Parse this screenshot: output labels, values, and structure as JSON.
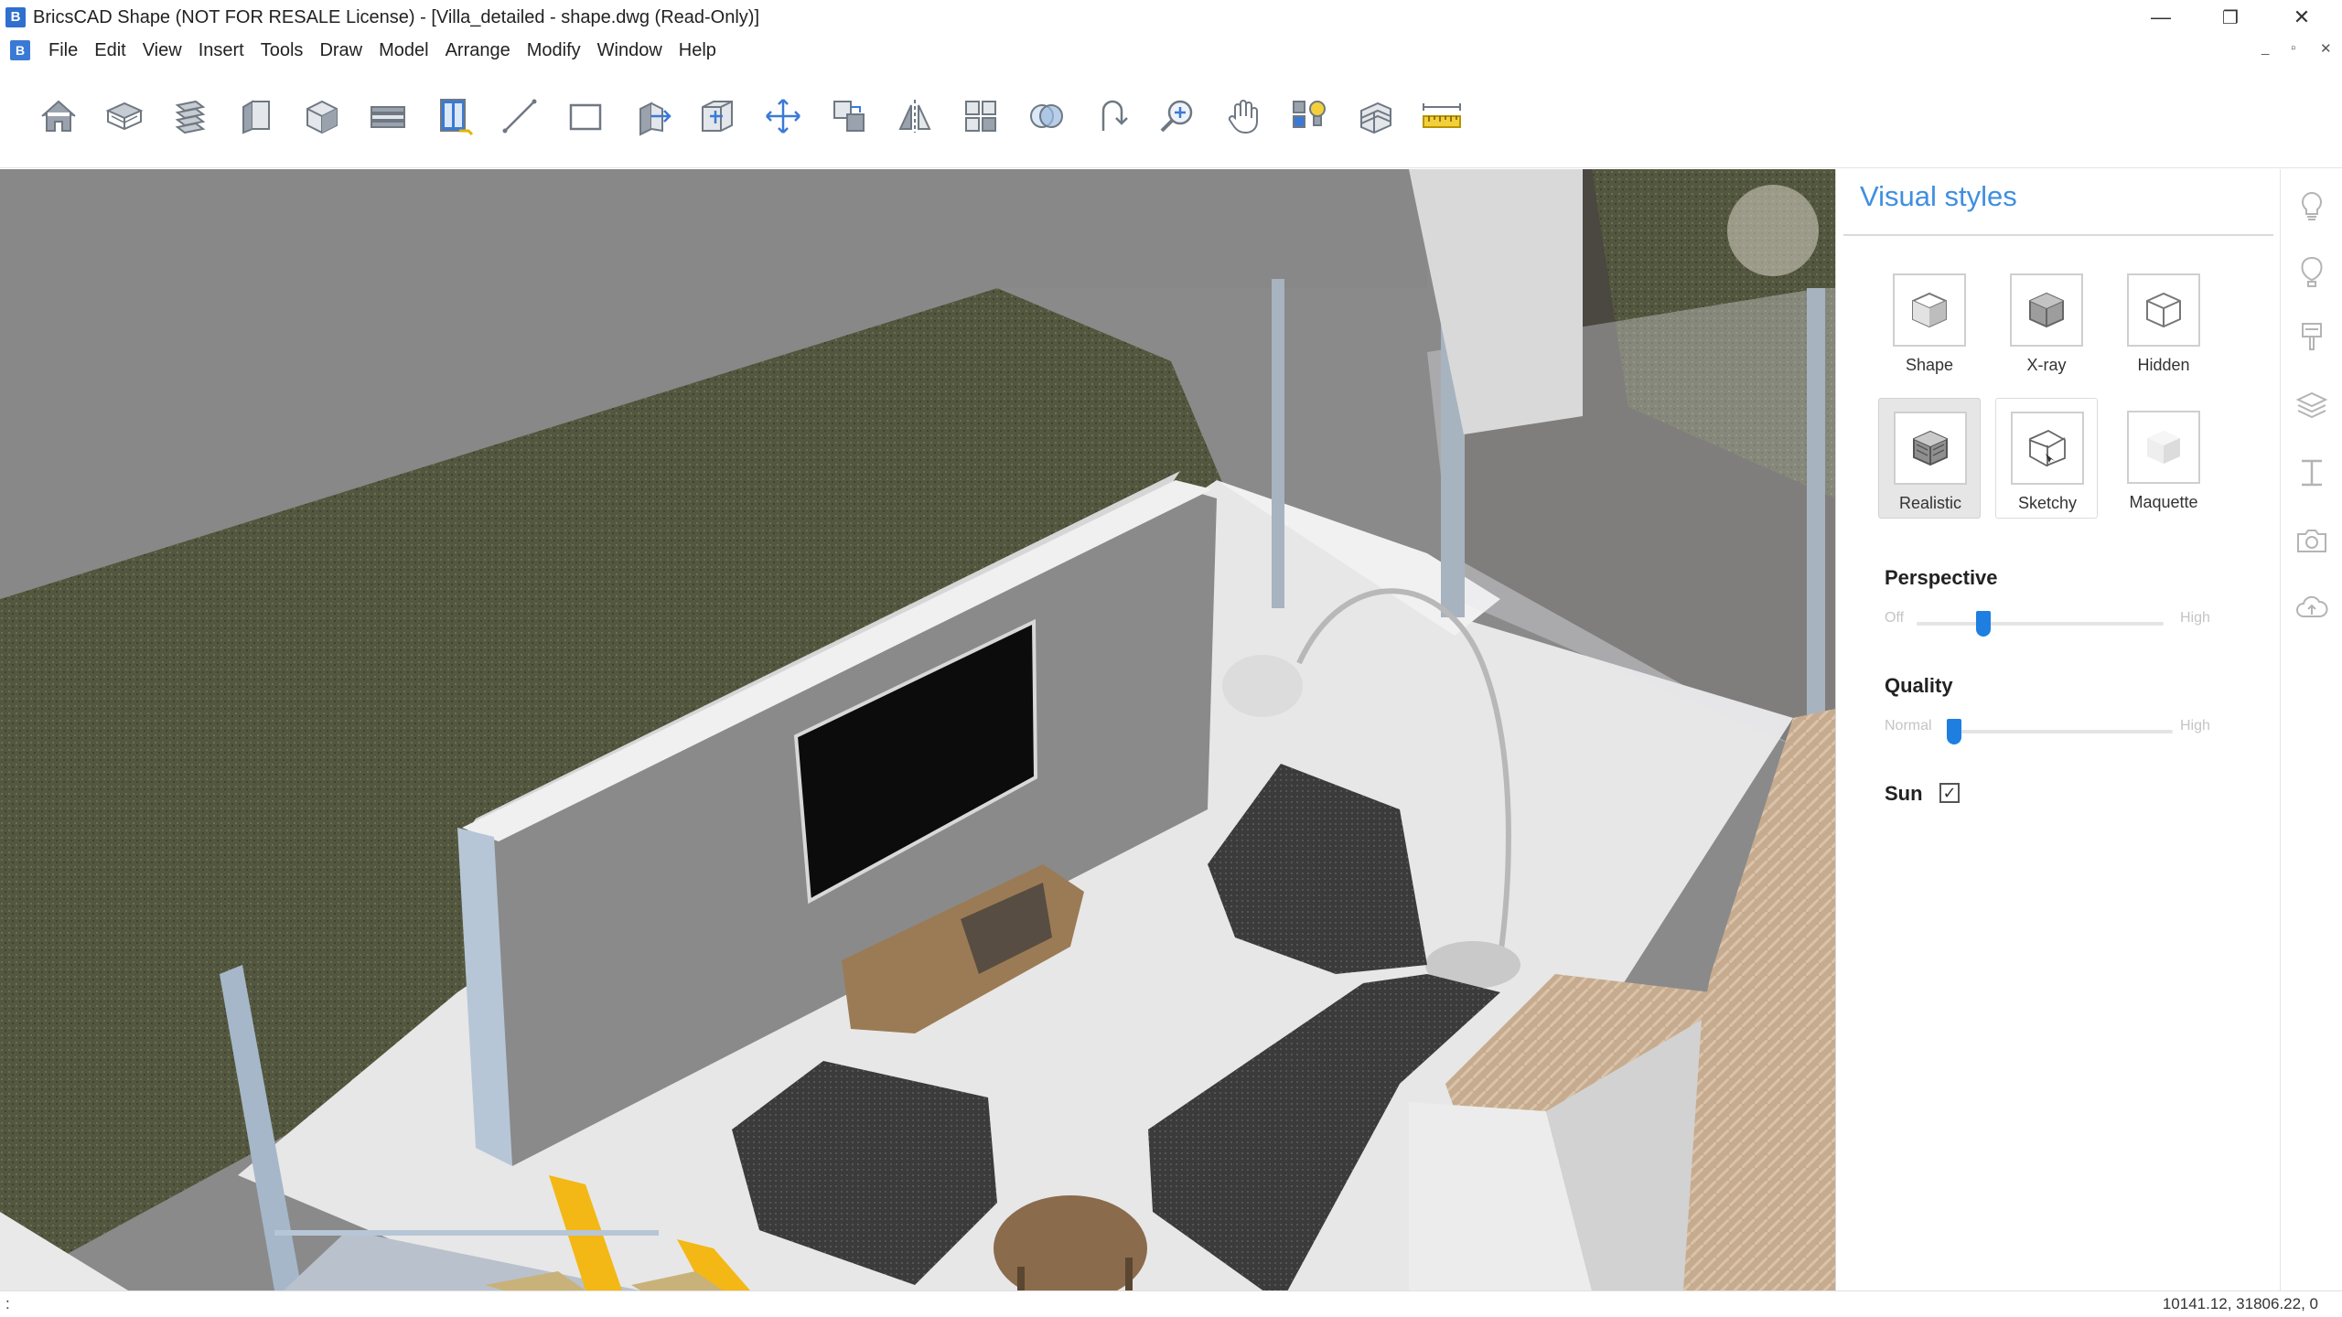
{
  "window": {
    "title": "BricsCAD Shape (NOT FOR RESALE License) - [Villa_detailed - shape.dwg (Read-Only)]",
    "app_icon": "bricscad-logo",
    "controls": {
      "minimize": "—",
      "restore": "❐",
      "close": "✕"
    },
    "doc_controls": {
      "minimize": "_",
      "restore": "▫",
      "close": "✕"
    }
  },
  "menu": {
    "items": [
      "File",
      "Edit",
      "View",
      "Insert",
      "Tools",
      "Draw",
      "Model",
      "Arrange",
      "Modify",
      "Window",
      "Help"
    ]
  },
  "toolbar": {
    "tools": [
      "home-icon",
      "floor-slab-icon",
      "stair-icon",
      "wall-icon",
      "box-icon",
      "beam-icon",
      "window-library-icon",
      "line-icon",
      "rectangle-icon",
      "push-pull-icon",
      "section-box-icon",
      "move-icon",
      "copy-icon",
      "mirror-icon",
      "array-icon",
      "solid-boolean-icon",
      "rotate-icon",
      "zoom-icon",
      "pan-icon",
      "lighting-icon",
      "layer-section-icon",
      "measure-tape-icon"
    ]
  },
  "panel": {
    "title": "Visual styles",
    "styles": [
      {
        "label": "Shape",
        "icon": "shape-cube-icon",
        "selected": false
      },
      {
        "label": "X-ray",
        "icon": "xray-cube-icon",
        "selected": false
      },
      {
        "label": "Hidden",
        "icon": "hidden-cube-icon",
        "selected": false
      },
      {
        "label": "Realistic",
        "icon": "realistic-cube-icon",
        "selected": true
      },
      {
        "label": "Sketchy",
        "icon": "sketchy-cube-icon",
        "selected": false
      },
      {
        "label": "Maquette",
        "icon": "maquette-cube-icon",
        "selected": false
      }
    ],
    "perspective": {
      "label": "Perspective",
      "min_label": "Off",
      "max_label": "High",
      "value": 0.27
    },
    "quality": {
      "label": "Quality",
      "min_label": "Normal",
      "max_label": "High",
      "value": 0.02
    },
    "sun": {
      "label": "Sun",
      "checked": true,
      "mark": "✓"
    }
  },
  "side_strip": {
    "icons": [
      "lightbulb-icon",
      "balloon-icon",
      "paint-brush-icon",
      "layers-icon",
      "dimension-icon",
      "camera-icon",
      "cloud-upload-icon"
    ]
  },
  "status": {
    "prompt": ":",
    "coordinates": "10141.12, 31806.22, 0"
  },
  "colors": {
    "accent": "#3f8fe0",
    "slider_thumb": "#1e7fe0",
    "logo": "#2f6fcf"
  }
}
